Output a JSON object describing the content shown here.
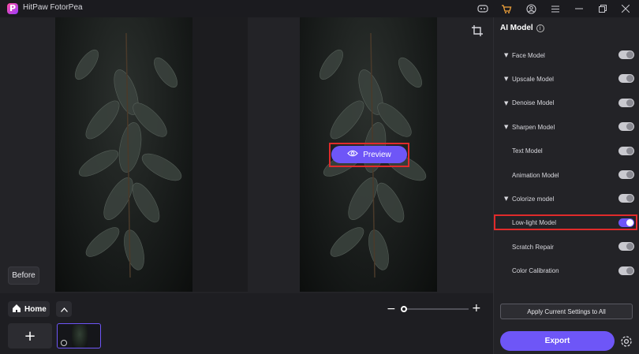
{
  "app": {
    "title": "HitPaw FotorPea"
  },
  "canvas": {
    "before_label": "Before",
    "preview_label": "Preview"
  },
  "bottom": {
    "home_label": "Home",
    "add_label": "+"
  },
  "panel": {
    "title": "AI Model",
    "models": [
      {
        "label": "Face Model",
        "expandable": true,
        "enabled": false
      },
      {
        "label": "Upscale Model",
        "expandable": true,
        "enabled": false
      },
      {
        "label": "Denoise Model",
        "expandable": true,
        "enabled": false
      },
      {
        "label": "Sharpen Model",
        "expandable": true,
        "enabled": false
      },
      {
        "label": "Text Model",
        "expandable": false,
        "enabled": false
      },
      {
        "label": "Animation Model",
        "expandable": false,
        "enabled": false
      },
      {
        "label": "Colorize model",
        "expandable": true,
        "enabled": false
      },
      {
        "label": "Low-light Model",
        "expandable": false,
        "enabled": true
      },
      {
        "label": "Scratch Repair",
        "expandable": false,
        "enabled": false
      },
      {
        "label": "Color Calibration",
        "expandable": false,
        "enabled": false
      }
    ],
    "apply_label": "Apply Current Settings to All",
    "export_label": "Export"
  },
  "colors": {
    "accent": "#6e56f7",
    "highlight": "#e02b2b"
  },
  "icons": [
    "discord-icon",
    "cart-icon",
    "account-icon",
    "menu-icon",
    "minimize-icon",
    "restore-icon",
    "close-icon",
    "crop-icon",
    "eye-icon",
    "home-icon",
    "chevron-up-icon",
    "gear-icon",
    "info-icon",
    "clock-icon"
  ]
}
